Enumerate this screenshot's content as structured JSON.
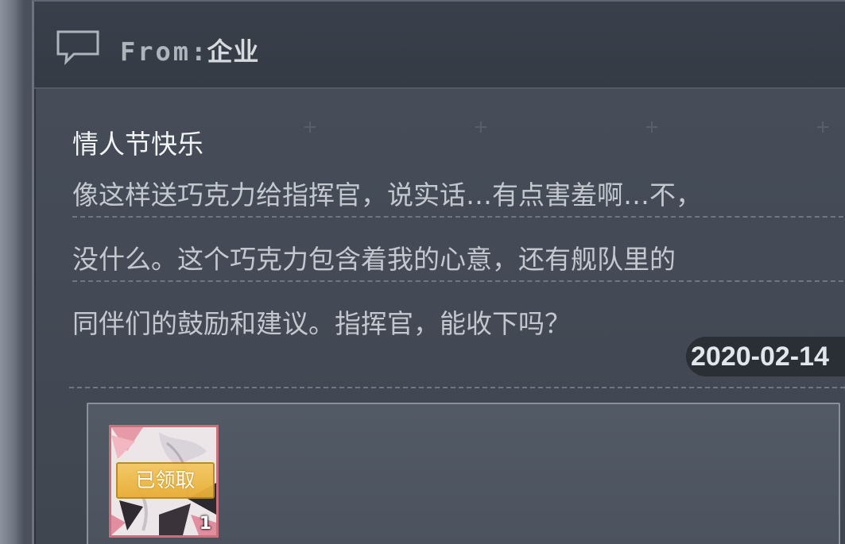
{
  "header": {
    "from_prefix": "From:",
    "sender": "企业",
    "icon": "chat-bubble-icon"
  },
  "mail": {
    "title": "情人节快乐",
    "body_lines": [
      "像这样送巧克力给指挥官，说实话…有点害羞啊…不，",
      "没什么。这个巧克力包含着我的心意，还有舰队里的",
      "同伴们的鼓励和建议。指挥官，能收下吗？"
    ],
    "date": "2020-02-14"
  },
  "attachments": {
    "items": [
      {
        "status": "已领取",
        "count": "1",
        "icon": "chocolate-gift-item-icon"
      }
    ]
  },
  "colors": {
    "panel": "#444b57",
    "header": "#373e48",
    "badge_gold": "#e8ad32",
    "item_border": "#c9707e"
  }
}
